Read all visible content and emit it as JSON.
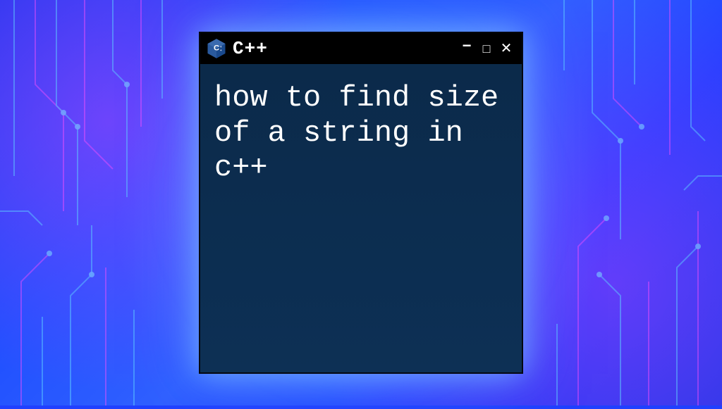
{
  "window": {
    "title": "C++",
    "icon": "cpp-logo-icon"
  },
  "terminal": {
    "content": "how to find size of a string in c++"
  },
  "controls": {
    "minimize": "−",
    "maximize": "□",
    "close": "✕"
  },
  "colors": {
    "terminal_bg": "#0a2a4a",
    "titlebar_bg": "#000000",
    "text": "#ffffff",
    "glow": "#96c8ff"
  }
}
